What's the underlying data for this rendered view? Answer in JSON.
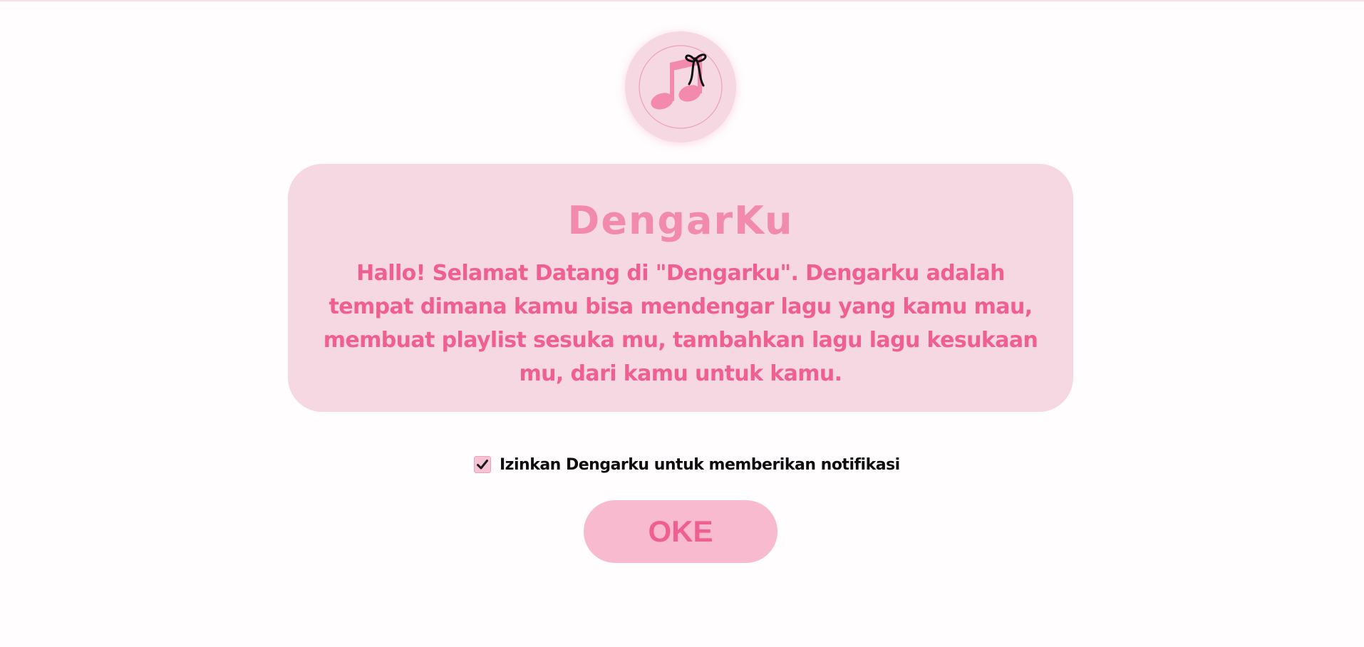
{
  "app": {
    "title": "DengarKu",
    "logo_icon": "music-note-with-bow-icon"
  },
  "welcome_card": {
    "message": "Hallo! Selamat Datang di \"Dengarku\". Dengarku adalah tempat dimana kamu bisa mendengar lagu yang kamu mau, membuat playlist sesuka mu, tambahkan lagu lagu kesukaan mu, dari kamu untuk kamu."
  },
  "notification_consent": {
    "label": "Izinkan Dengarku untuk memberikan notifikasi",
    "checked": true
  },
  "confirm_button": {
    "label": "OKE"
  },
  "colors": {
    "background": "#fffdfe",
    "card": "#f6d8e3",
    "title": "#f28aad",
    "accent_text": "#ef5f90",
    "button": "#f7bace",
    "note": "#f389ad",
    "bow": "#111111"
  }
}
